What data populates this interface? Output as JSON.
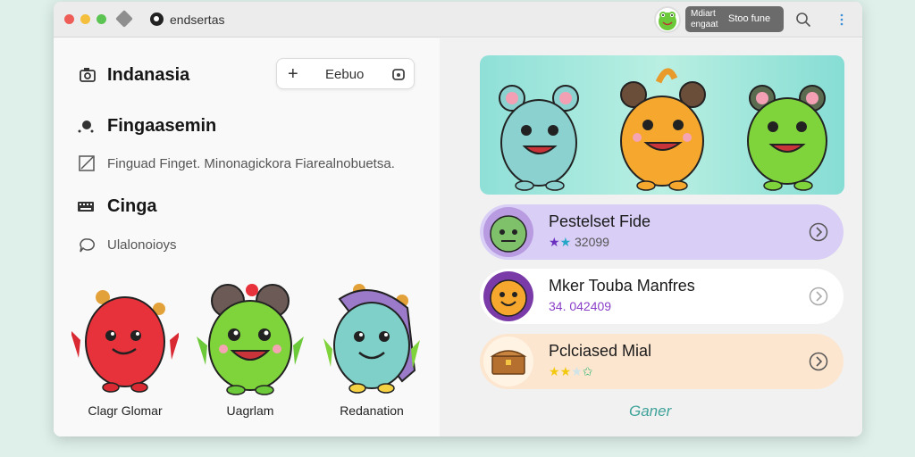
{
  "titlebar": {
    "app_title": "endsertas",
    "user_chip": {
      "line1": "Mdiart",
      "line2": "engaat",
      "right": "Stoo fune"
    }
  },
  "left": {
    "section1": {
      "title": "Indanasia",
      "button_label": "Eebuo"
    },
    "section2": {
      "title": "Fingaasemin",
      "subtitle": "Finguad Finget. Minonagickora Fiarealnobuetsa."
    },
    "section3": {
      "title": "Cinga",
      "subtitle": "Ulalonoioys"
    },
    "characters": [
      {
        "name": "Clagr Glomar",
        "color": "#e8323b"
      },
      {
        "name": "Uagrlam",
        "color": "#7fd43c"
      },
      {
        "name": "Redanation",
        "color": "#7ed0c8"
      }
    ]
  },
  "right": {
    "cards": [
      {
        "title": "Pestelset Fide",
        "meta": "32099",
        "bg": "#d9cef5"
      },
      {
        "title": "Mker Touba Manfres",
        "meta": "34. 042409",
        "bg": "#ffffff"
      },
      {
        "title": "Pclciased Mial",
        "meta": "",
        "bg": "#fde6d0"
      }
    ],
    "footer_link": "Ganer"
  },
  "icons": {
    "camera": "camera-icon",
    "dots": "dots-icon",
    "edit": "edit-icon",
    "keyboard": "keyboard-icon",
    "chat": "chat-icon",
    "search": "search-icon",
    "more": "more-icon"
  }
}
